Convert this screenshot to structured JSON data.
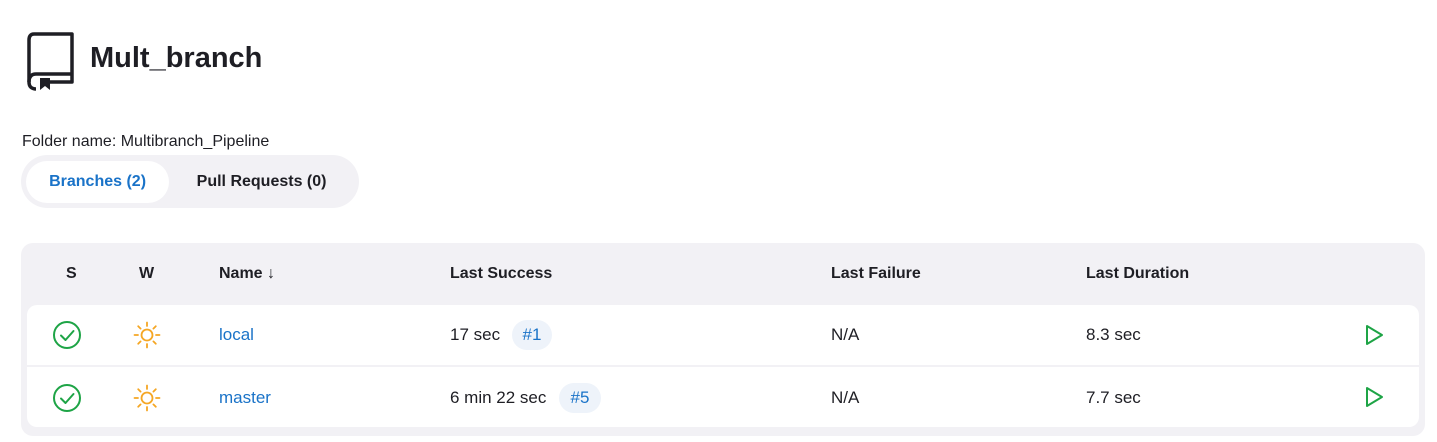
{
  "header": {
    "icon": "repository-book-icon",
    "title": "Mult_branch"
  },
  "folder": {
    "label": "Folder name:",
    "value": "Multibranch_Pipeline"
  },
  "tabs": [
    {
      "label": "Branches (2)",
      "active": true
    },
    {
      "label": "Pull Requests (0)",
      "active": false
    }
  ],
  "table": {
    "columns": {
      "s": "S",
      "w": "W",
      "name": "Name ↓",
      "last_success": "Last Success",
      "last_failure": "Last Failure",
      "last_duration": "Last Duration"
    },
    "rows": [
      {
        "status_icon": "success-check-icon",
        "weather_icon": "sunny-icon",
        "name": "local",
        "last_success": "17 sec",
        "last_success_build": "#1",
        "last_failure": "N/A",
        "last_duration": "8.3 sec",
        "action_icon": "play-icon"
      },
      {
        "status_icon": "success-check-icon",
        "weather_icon": "sunny-icon",
        "name": "master",
        "last_success": "6 min 22 sec",
        "last_success_build": "#5",
        "last_failure": "N/A",
        "last_duration": "7.7 sec",
        "action_icon": "play-icon"
      }
    ]
  },
  "colors": {
    "accent": "#1a73c8",
    "success": "#1ea446",
    "weather": "#f5a623",
    "surface": "#f2f1f5"
  }
}
